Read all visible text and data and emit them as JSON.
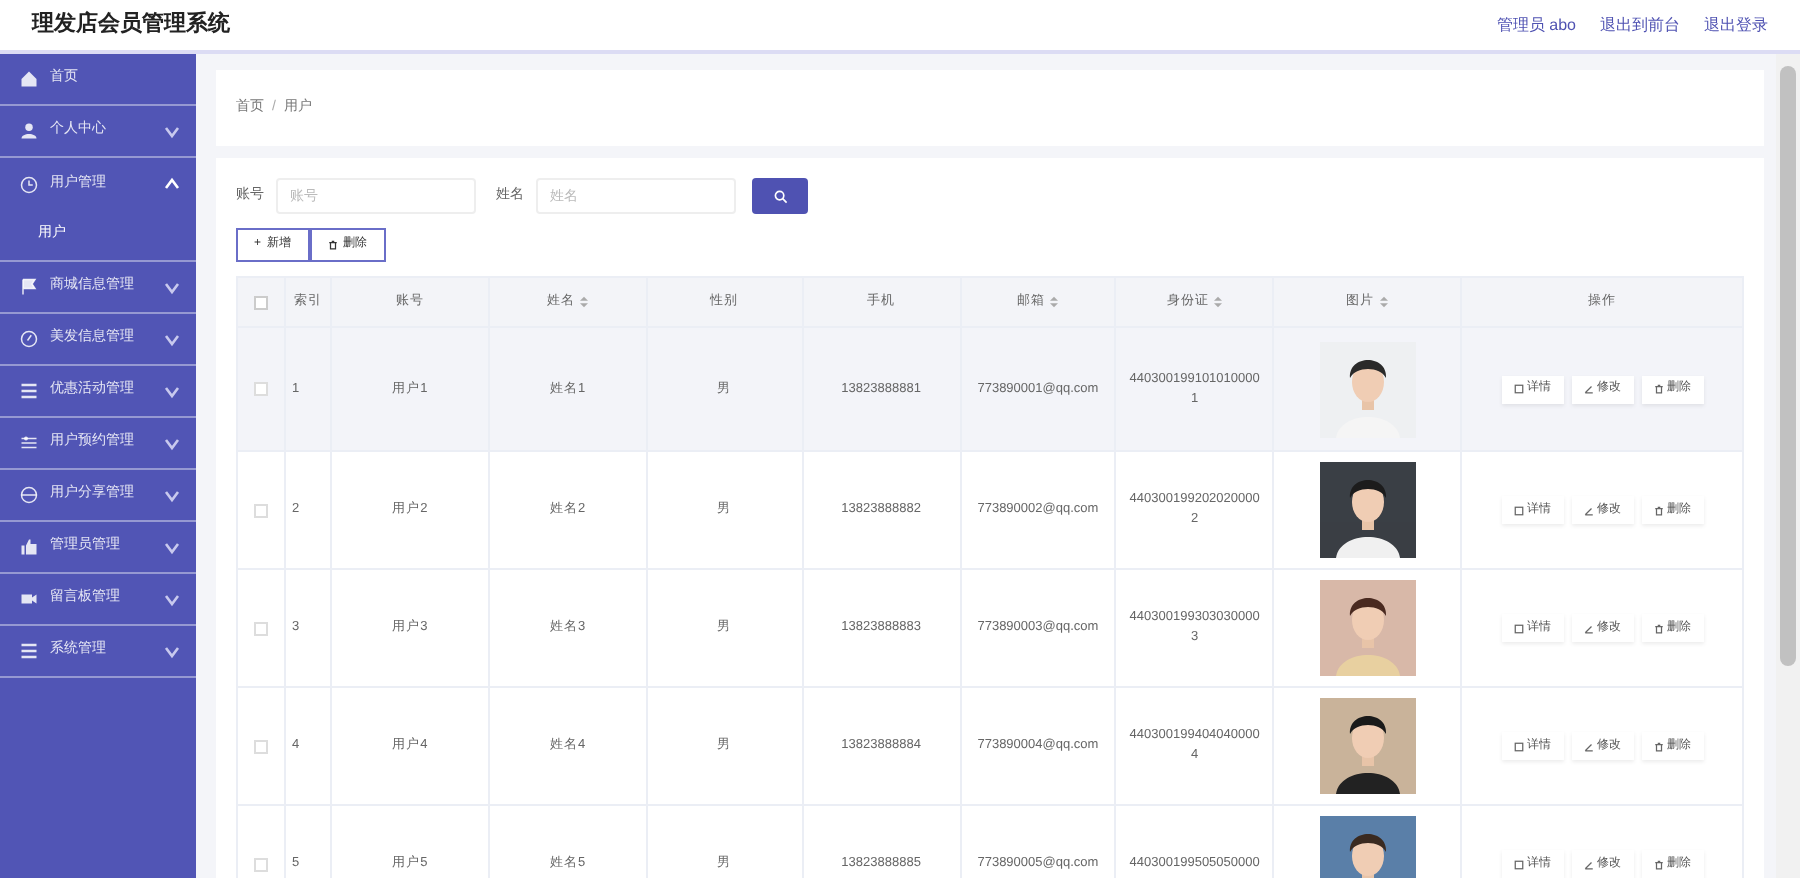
{
  "header": {
    "title": "理发店会员管理系统",
    "links": [
      "管理员 abo",
      "退出到前台",
      "退出登录"
    ]
  },
  "sidebar": {
    "items": [
      {
        "label": "首页",
        "kind": "link"
      },
      {
        "label": "个人中心",
        "kind": "group",
        "expanded": false
      },
      {
        "label": "用户管理",
        "kind": "group",
        "expanded": true,
        "children": [
          {
            "label": "用户"
          }
        ]
      },
      {
        "label": "商城信息管理",
        "kind": "group",
        "expanded": false
      },
      {
        "label": "美发信息管理",
        "kind": "group",
        "expanded": false
      },
      {
        "label": "优惠活动管理",
        "kind": "group",
        "expanded": false
      },
      {
        "label": "用户预约管理",
        "kind": "group",
        "expanded": false
      },
      {
        "label": "用户分享管理",
        "kind": "group",
        "expanded": false
      },
      {
        "label": "管理员管理",
        "kind": "group",
        "expanded": false
      },
      {
        "label": "留言板管理",
        "kind": "group",
        "expanded": false
      },
      {
        "label": "系统管理",
        "kind": "group",
        "expanded": false
      }
    ]
  },
  "breadcrumb": [
    "首页",
    "/",
    "用户"
  ],
  "search": {
    "fields": [
      {
        "label": "账号",
        "placeholder": "账号"
      },
      {
        "label": "姓名",
        "placeholder": "姓名"
      }
    ]
  },
  "actions": [
    {
      "symbol": "+",
      "label": "新增"
    },
    {
      "label": "删除"
    }
  ],
  "table": {
    "header_checkbox": {
      "checked": false
    },
    "columns": [
      {
        "label": "索引",
        "sortable": false
      },
      {
        "label": "账号",
        "sortable": false
      },
      {
        "label": "姓名",
        "sortable": true
      },
      {
        "label": "性别",
        "sortable": false
      },
      {
        "label": "手机",
        "sortable": false
      },
      {
        "label": "邮箱",
        "sortable": true
      },
      {
        "label": "身份证",
        "sortable": true
      },
      {
        "label": "图片",
        "sortable": true
      },
      {
        "label": "操作",
        "sortable": false
      }
    ],
    "rows": [
      {
        "checked": false,
        "highlighted": true,
        "cells": [
          "1",
          "用户1",
          "姓名1",
          "男",
          "13823888881",
          "773890001@qq.com",
          "4403001991010100001"
        ],
        "buttons": [
          "详情",
          "修改",
          "删除"
        ]
      },
      {
        "checked": false,
        "highlighted": false,
        "cells": [
          "2",
          "用户2",
          "姓名2",
          "男",
          "13823888882",
          "773890002@qq.com",
          "4403001992020200002"
        ],
        "buttons": [
          "详情",
          "修改",
          "删除"
        ]
      },
      {
        "checked": false,
        "highlighted": false,
        "cells": [
          "3",
          "用户3",
          "姓名3",
          "男",
          "13823888883",
          "773890003@qq.com",
          "4403001993030300003"
        ],
        "buttons": [
          "详情",
          "修改",
          "删除"
        ]
      },
      {
        "checked": false,
        "highlighted": false,
        "cells": [
          "4",
          "用户4",
          "姓名4",
          "男",
          "13823888884",
          "773890004@qq.com",
          "4403001994040400004"
        ],
        "buttons": [
          "详情",
          "修改",
          "删除"
        ]
      },
      {
        "checked": false,
        "highlighted": false,
        "cells": [
          "5",
          "用户5",
          "姓名5",
          "男",
          "13823888885",
          "773890005@qq.com",
          "440300199505050000"
        ],
        "buttons": [
          "详情",
          "修改",
          "删除"
        ]
      }
    ]
  }
}
